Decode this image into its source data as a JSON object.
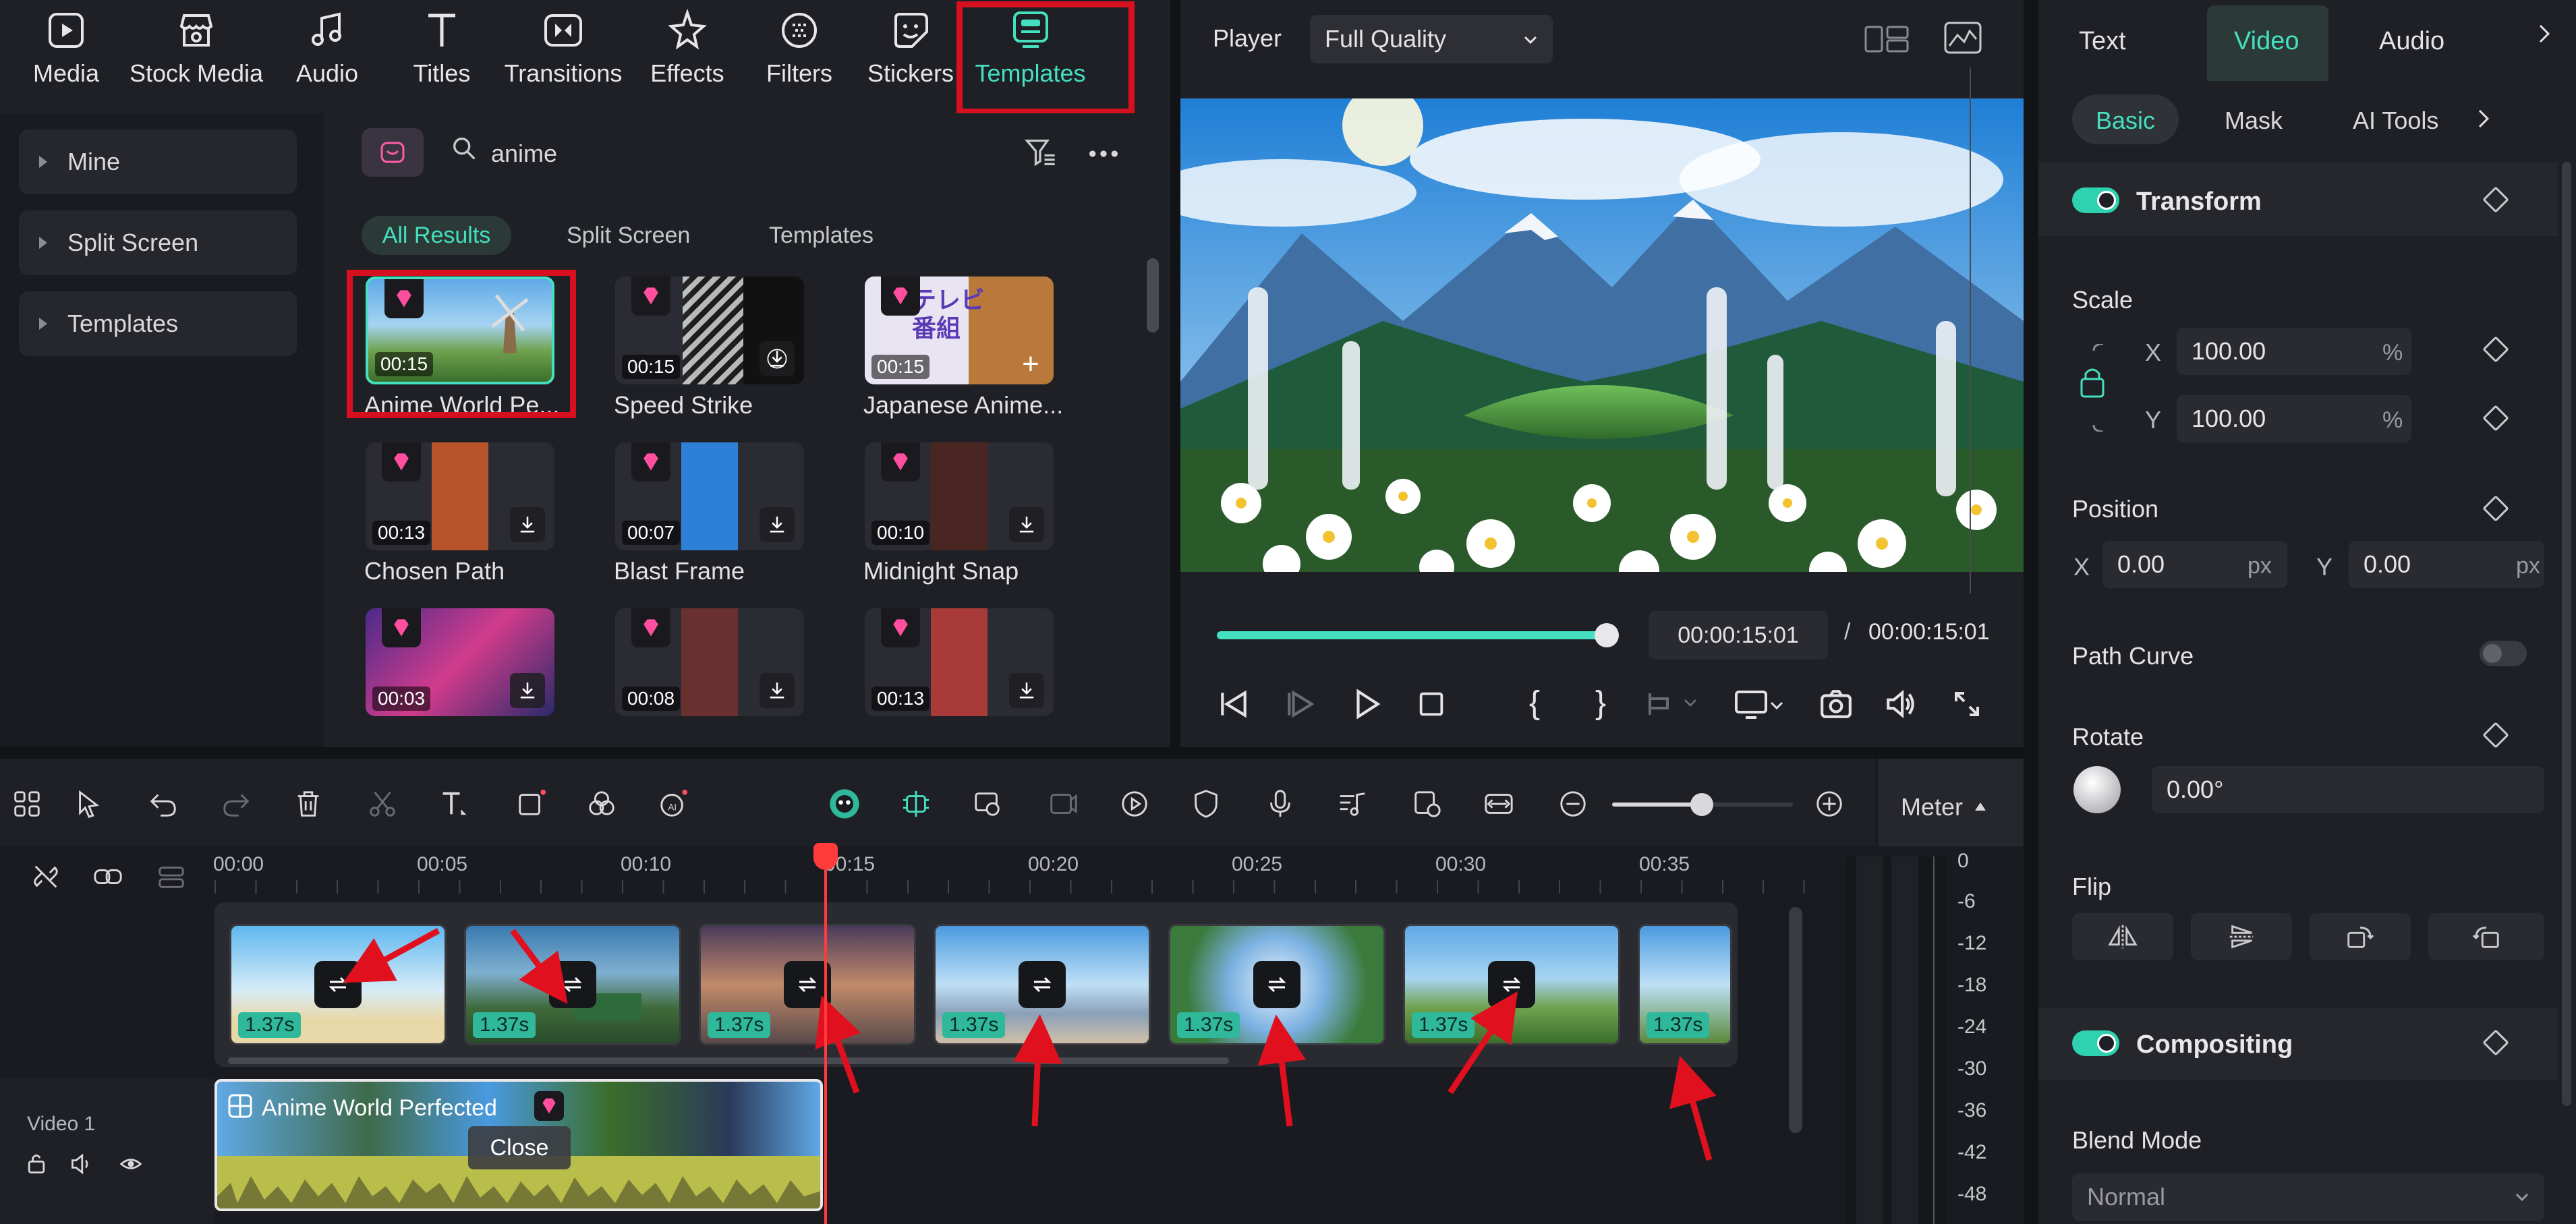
{
  "toolbar": {
    "tabs": [
      {
        "label": "Media",
        "icon": "media-icon"
      },
      {
        "label": "Stock Media",
        "icon": "stock-media-icon"
      },
      {
        "label": "Audio",
        "icon": "audio-icon"
      },
      {
        "label": "Titles",
        "icon": "titles-icon"
      },
      {
        "label": "Transitions",
        "icon": "transitions-icon"
      },
      {
        "label": "Effects",
        "icon": "effects-icon"
      },
      {
        "label": "Filters",
        "icon": "filters-icon"
      },
      {
        "label": "Stickers",
        "icon": "stickers-icon"
      },
      {
        "label": "Templates",
        "icon": "templates-icon"
      }
    ],
    "active_tab": "Templates"
  },
  "library": {
    "sidebar": [
      "Mine",
      "Split Screen",
      "Templates"
    ],
    "search_value": "anime",
    "filters": [
      "All Results",
      "Split Screen",
      "Templates"
    ],
    "active_filter": "All Results",
    "templates": [
      {
        "name": "Anime World Pe...",
        "duration": "00:15"
      },
      {
        "name": "Speed Strike",
        "duration": "00:15"
      },
      {
        "name": "Japanese Anime...",
        "duration": "00:15"
      },
      {
        "name": "Chosen Path",
        "duration": "00:13"
      },
      {
        "name": "Blast Frame",
        "duration": "00:07"
      },
      {
        "name": "Midnight Snap",
        "duration": "00:10"
      },
      {
        "name": "",
        "duration": "00:03"
      },
      {
        "name": "",
        "duration": "00:08"
      },
      {
        "name": "",
        "duration": "00:13"
      }
    ],
    "sticker_text": "テレビ 番組"
  },
  "player": {
    "label": "Player",
    "quality": "Full Quality",
    "current_time": "00:00:15:01",
    "separator": "/",
    "total_time": "00:00:15:01",
    "progress": 1.0,
    "mark_in": "{",
    "mark_out": "}"
  },
  "inspector": {
    "tabs": [
      "Text",
      "Video",
      "Audio"
    ],
    "active_tab": "Video",
    "subtabs": [
      "Basic",
      "Mask",
      "AI Tools"
    ],
    "active_subtab": "Basic",
    "transform": {
      "title": "Transform",
      "scale_label": "Scale",
      "scale_x": "100.00",
      "scale_y": "100.00",
      "scale_unit": "%",
      "axis_x": "X",
      "axis_y": "Y",
      "position_label": "Position",
      "pos_x": "0.00",
      "pos_y": "0.00",
      "pos_unit": "px",
      "path_curve_label": "Path Curve",
      "rotate_label": "Rotate",
      "rotate_value": "0.00°",
      "flip_label": "Flip"
    },
    "compositing": {
      "title": "Compositing",
      "blend_label": "Blend Mode",
      "blend_value": "Normal"
    }
  },
  "timeline": {
    "ruler": [
      "00:00",
      "00:05",
      "00:10",
      "00:15",
      "00:20",
      "00:25",
      "00:30",
      "00:35"
    ],
    "playhead_time": "00:15",
    "clip_duration": "1.37s",
    "clip_count": 7,
    "track_label": "Video 1",
    "main_clip_title": "Anime World Perfected",
    "close_label": "Close",
    "meter_label": "Meter",
    "meter_scale": [
      "0",
      "-6",
      "-12",
      "-18",
      "-24",
      "-30",
      "-36",
      "-42",
      "-48"
    ]
  },
  "colors": {
    "accent": "#44e0c0",
    "highlight": "#d6101e",
    "playhead": "#ff3b3b",
    "panel": "#1f2025"
  }
}
